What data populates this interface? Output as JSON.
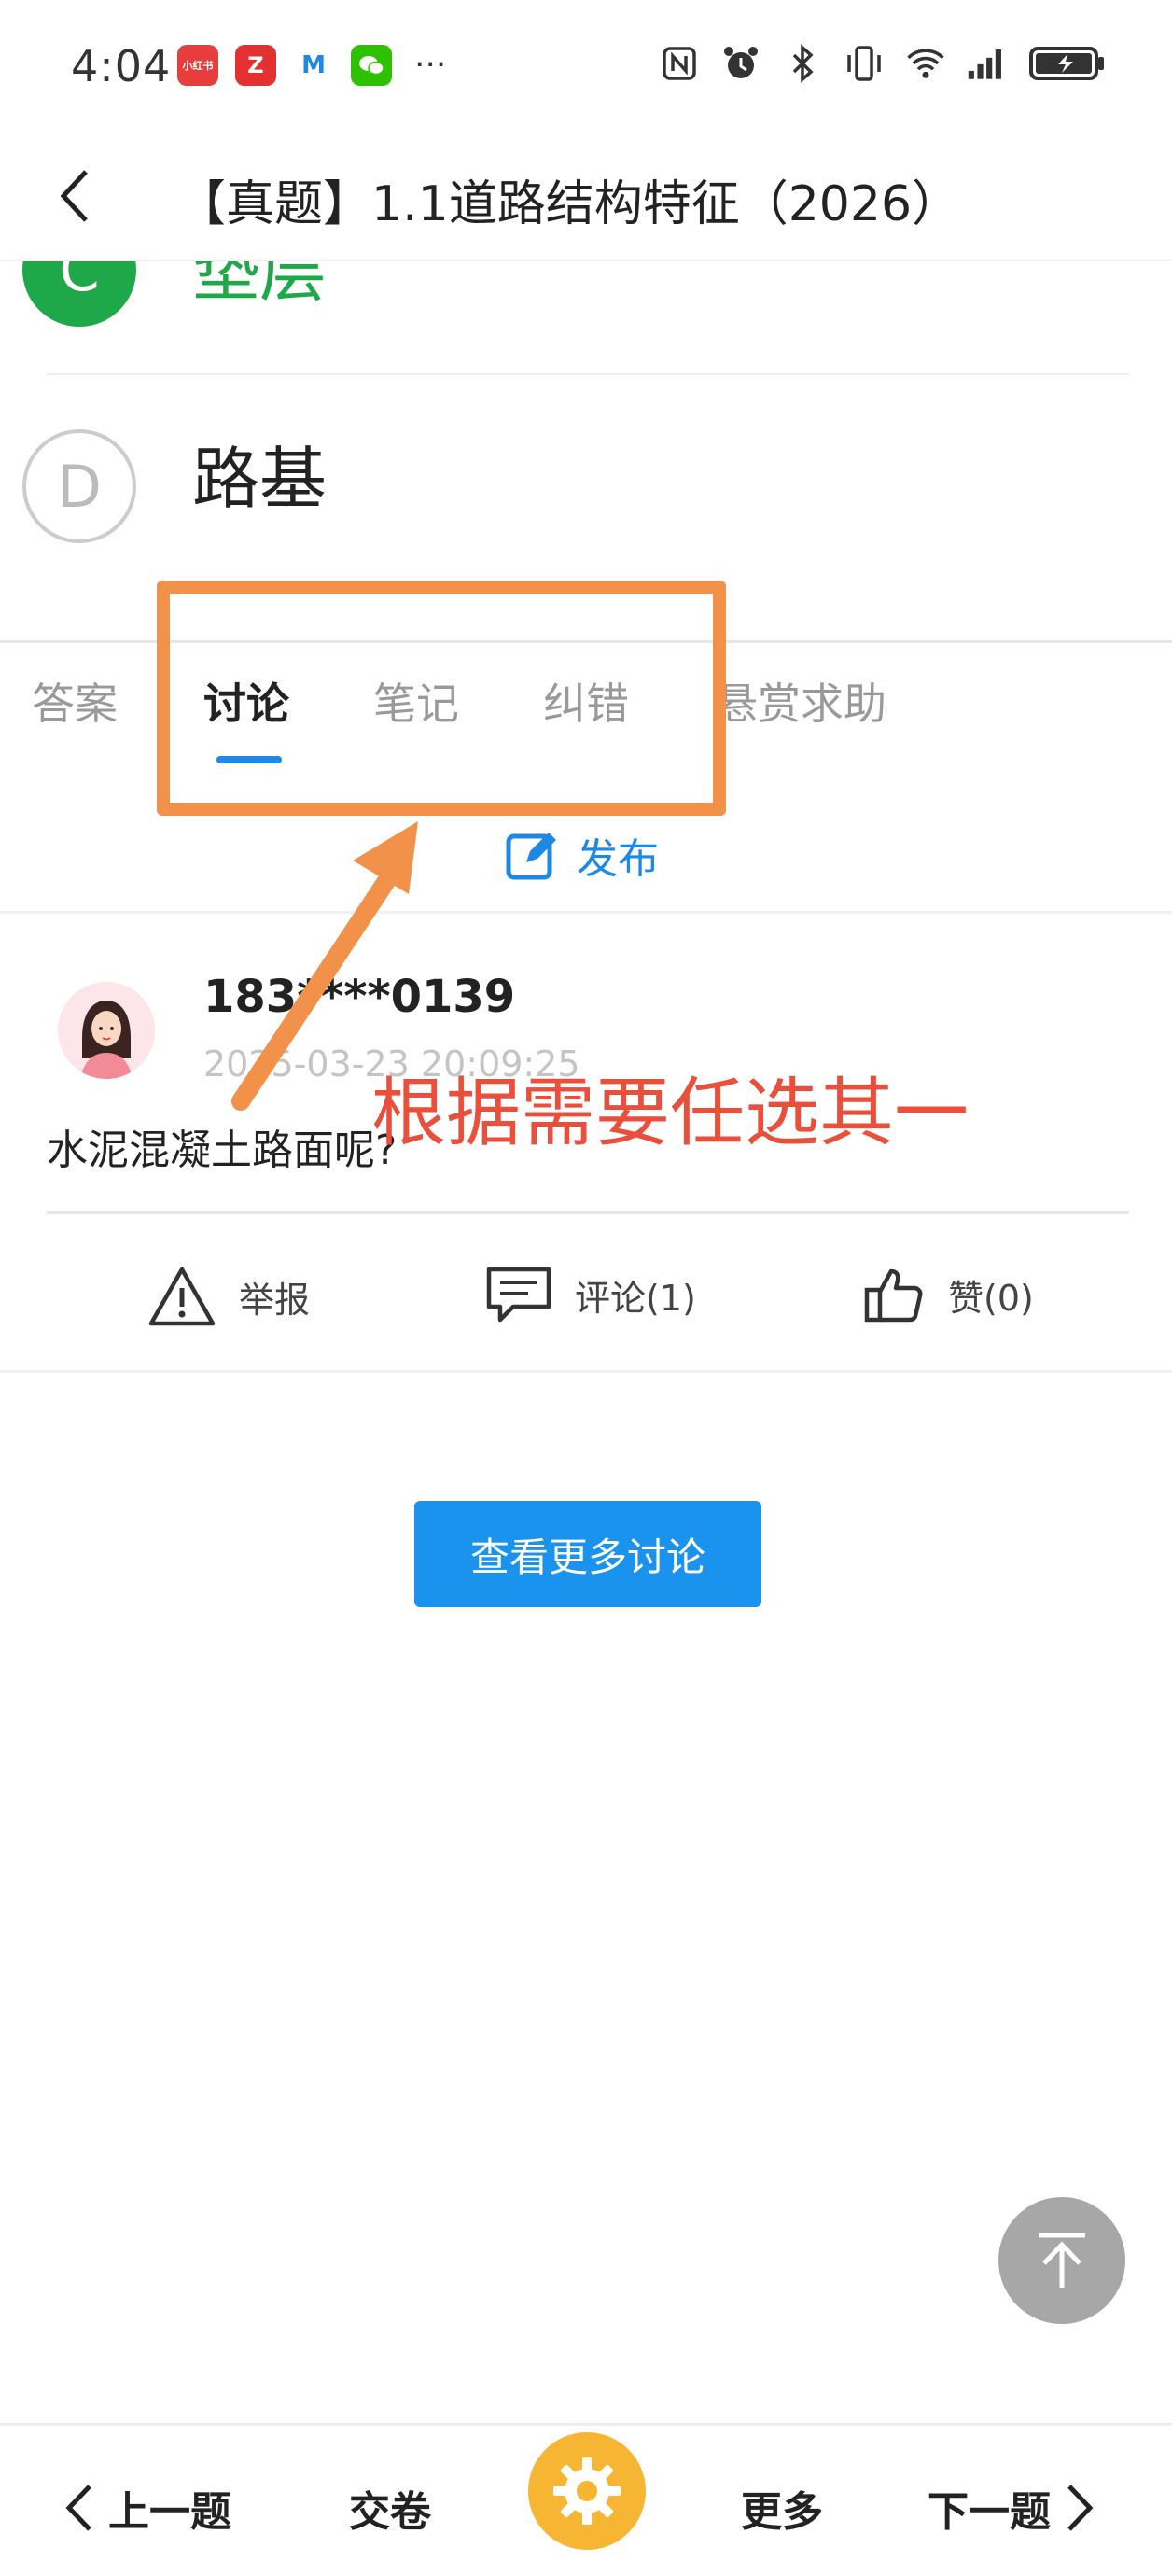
{
  "status_bar": {
    "time": "4:04",
    "app_icons": [
      {
        "name": "xiaohongshu-app-icon",
        "color": "#e83d3d",
        "text": "小红书"
      },
      {
        "name": "zuoyebang-app-icon",
        "color": "#e33030",
        "text": "Z"
      },
      {
        "name": "m-app-icon",
        "color": "#ffffff",
        "text": "M"
      },
      {
        "name": "wechat-app-icon",
        "color": "#2dc100",
        "text": ""
      }
    ],
    "more": "···"
  },
  "header": {
    "title": "【真题】1.1道路结构特征（2026）"
  },
  "options": [
    {
      "letter": "C",
      "text": "垫层"
    },
    {
      "letter": "D",
      "text": "路基"
    }
  ],
  "tabs": {
    "items": [
      "答案",
      "讨论",
      "笔记",
      "纠错",
      "悬赏求助"
    ],
    "active": "讨论"
  },
  "publish_label": "发布",
  "comment": {
    "username": "183****0139",
    "timestamp": "2025-03-23 20:09:25",
    "text": "水泥混凝土路面呢?",
    "actions": {
      "report": "举报",
      "comment": "评论(1)",
      "like": "赞(0)"
    }
  },
  "annotation": "根据需要任选其一",
  "more_discussions_label": "查看更多讨论",
  "bottom_bar": {
    "prev": "上一题",
    "submit": "交卷",
    "more": "更多",
    "next": "下一题"
  },
  "colors": {
    "accent": "#1e88e5",
    "highlight": "#f2914a",
    "annotation": "#e94f3b",
    "option_green": "#1ea84a",
    "settings": "#f6b533"
  }
}
